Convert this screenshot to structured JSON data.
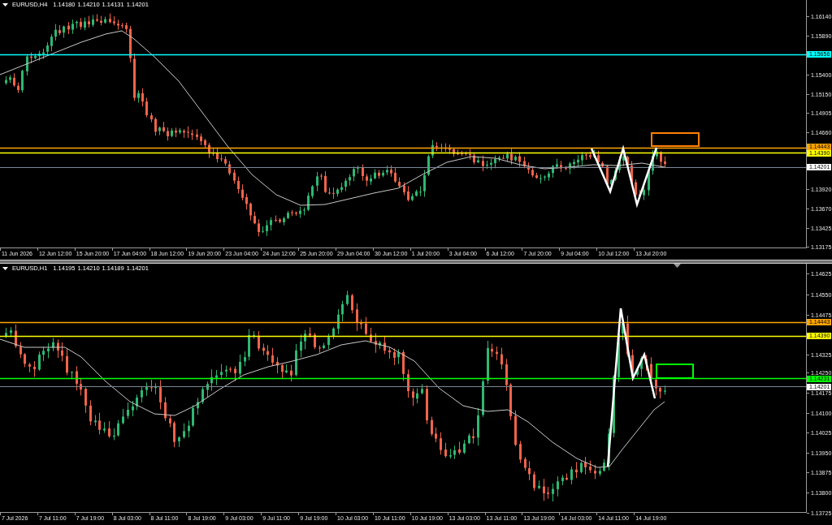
{
  "charts": [
    {
      "symbol": "EURUSD,H4",
      "ohlc": [
        "1.14180",
        "1.14210",
        "1.14131",
        "1.14201"
      ],
      "price_axis": [
        "1.16140",
        "1.15890",
        "1.15400",
        "1.15150",
        "1.14905",
        "1.14660",
        "1.13920",
        "1.13670",
        "1.13425",
        "1.13175"
      ],
      "price_levels": [
        {
          "kind": "level",
          "label": "1.15656",
          "color": "#00ffff"
        },
        {
          "kind": "level",
          "label": "1.14443",
          "color": "#ffa500"
        },
        {
          "kind": "level",
          "label": "1.14390",
          "color": "#ffff00"
        },
        {
          "kind": "bid",
          "label": "1.14201",
          "color": "#ffffff"
        }
      ],
      "rectangle": {
        "color": "#ff8000"
      },
      "time_axis": [
        "11 Jun 2026",
        "12 Jun 12:00",
        "15 Jun 20:00",
        "17 Jun 04:00",
        "18 Jun 12:00",
        "19 Jun 20:00",
        "23 Jun 04:00",
        "24 Jun 12:00",
        "25 Jun 20:00",
        "29 Jun 04:00",
        "30 Jun 12:00",
        "1 Jul 20:00",
        "3 Jul 04:00",
        "6 Jul 12:00",
        "7 Jul 20:00",
        "9 Jul 04:00",
        "10 Jul 12:00",
        "13 Jul 20:00"
      ]
    },
    {
      "symbol": "EURUSD,H1",
      "ohlc": [
        "1.14195",
        "1.14210",
        "1.14189",
        "1.14201"
      ],
      "price_axis": [
        "1.14625",
        "1.14550",
        "1.14475",
        "1.14325",
        "1.14250",
        "1.14175",
        "1.14100",
        "1.14025",
        "1.13950",
        "1.13875",
        "1.13800",
        "1.13725"
      ],
      "price_levels": [
        {
          "kind": "level",
          "label": "1.14443",
          "color": "#ffa500"
        },
        {
          "kind": "level",
          "label": "1.14390",
          "color": "#ffff00"
        },
        {
          "kind": "level",
          "label": "1.14231",
          "color": "#00ff00"
        },
        {
          "kind": "bid",
          "label": "1.14201",
          "color": "#ffffff"
        }
      ],
      "rectangle": {
        "color": "#00ff00"
      },
      "time_axis": [
        "7 Jul 2026",
        "7 Jul 11:00",
        "7 Jul 19:00",
        "8 Jul 03:00",
        "8 Jul 11:00",
        "8 Jul 19:00",
        "9 Jul 03:00",
        "9 Jul 11:00",
        "9 Jul 19:00",
        "10 Jul 03:00",
        "10 Jul 11:00",
        "10 Jul 19:00",
        "13 Jul 03:00",
        "13 Jul 11:00",
        "13 Jul 19:00",
        "14 Jul 03:00",
        "14 Jul 11:00",
        "14 Jul 19:00"
      ]
    }
  ]
}
